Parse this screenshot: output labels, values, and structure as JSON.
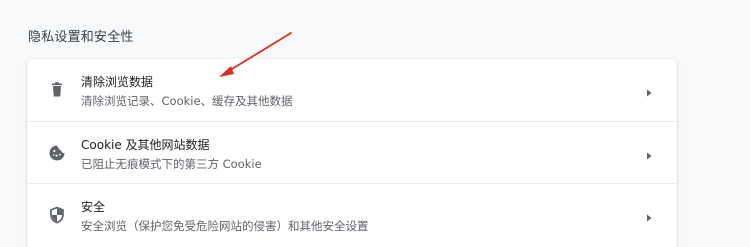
{
  "section": {
    "title": "隐私设置和安全性"
  },
  "rows": [
    {
      "title": "清除浏览数据",
      "subtitle": "清除浏览记录、Cookie、缓存及其他数据",
      "icon": "trash-icon"
    },
    {
      "title": "Cookie 及其他网站数据",
      "subtitle": "已阻止无痕模式下的第三方 Cookie",
      "icon": "cookie-icon"
    },
    {
      "title": "安全",
      "subtitle": "安全浏览（保护您免受危险网站的侵害）和其他安全设置",
      "icon": "shield-icon"
    }
  ],
  "colors": {
    "annotation_arrow": "#d93025",
    "icon": "#5f6368",
    "arrow": "#5f6368"
  }
}
